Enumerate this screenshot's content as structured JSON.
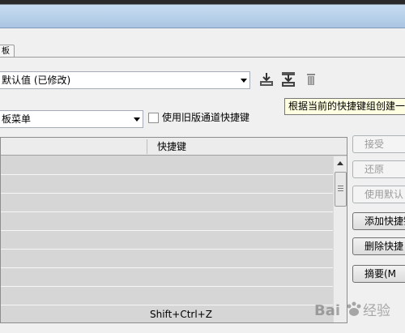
{
  "tab": {
    "label": "板"
  },
  "set_select": {
    "value": "默认值 (已修改)"
  },
  "toolbar": {
    "save_icon": "save-icon",
    "new_set_icon": "new-set-icon",
    "delete_icon": "trash-icon"
  },
  "tooltip": {
    "text": "根据当前的快捷键组创建一"
  },
  "menu_select": {
    "value": "板菜单"
  },
  "legacy_channel": {
    "label": "使用旧版通道快捷键",
    "checked": false
  },
  "table": {
    "headers": [
      "",
      "快捷键"
    ],
    "rows": [
      {
        "shortcut": ""
      },
      {
        "shortcut": ""
      },
      {
        "shortcut": ""
      },
      {
        "shortcut": ""
      },
      {
        "shortcut": ""
      },
      {
        "shortcut": ""
      },
      {
        "shortcut": ""
      },
      {
        "shortcut": ""
      },
      {
        "shortcut": "Shift+Ctrl+Z"
      }
    ]
  },
  "buttons": {
    "accept": "接受",
    "undo": "还原",
    "use_default": "使用默认",
    "add_shortcut": "添加快捷键",
    "delete_shortcut": "删除快捷",
    "summarize": "摘要(M"
  },
  "watermark": {
    "text": "Bai 经验"
  }
}
